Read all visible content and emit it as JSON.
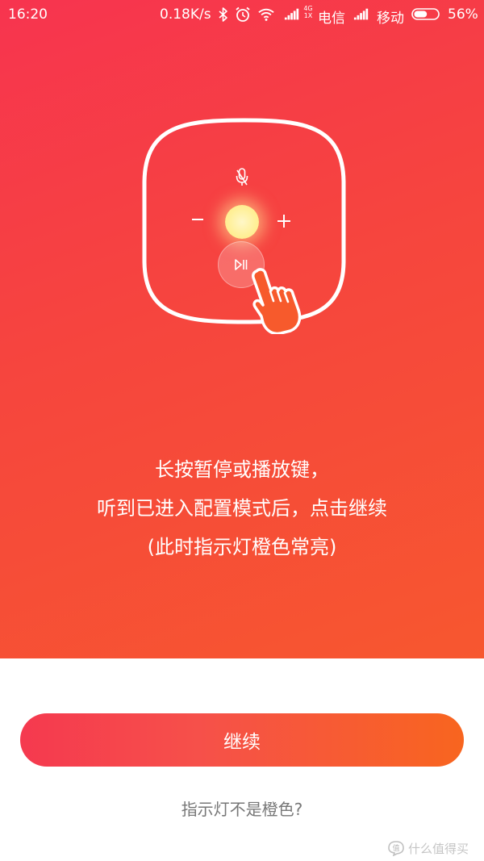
{
  "status_bar": {
    "time": "16:20",
    "speed": "0.18K/s",
    "network_type_top": "4G",
    "network_type_bottom": "1X",
    "carrier_1": "电信",
    "carrier_2": "移动",
    "battery": "56%",
    "battery_level": 0.56,
    "icons": [
      "bluetooth-icon",
      "alarm-icon",
      "wifi-icon",
      "signal-icon",
      "signal-icon",
      "battery-icon"
    ]
  },
  "illustration": {
    "icons": [
      "speaker-outline",
      "mic-icon",
      "minus-icon",
      "plus-icon",
      "light-indicator",
      "play-pause-icon",
      "hand-pointer-icon"
    ],
    "light_color": "#fff09a"
  },
  "instructions": {
    "line1": "长按暂停或播放键，",
    "line2": "听到已进入配置模式后，点击继续",
    "line3": "(此时指示灯橙色常亮)"
  },
  "actions": {
    "continue_label": "继续",
    "help_link": "指示灯不是橙色?"
  },
  "watermark": {
    "text": "什么值得买"
  },
  "colors": {
    "gradient_start": "#f7344f",
    "gradient_end": "#f7572f",
    "button_start": "#f5394f",
    "button_end": "#f8651f",
    "help_text": "#777777"
  }
}
